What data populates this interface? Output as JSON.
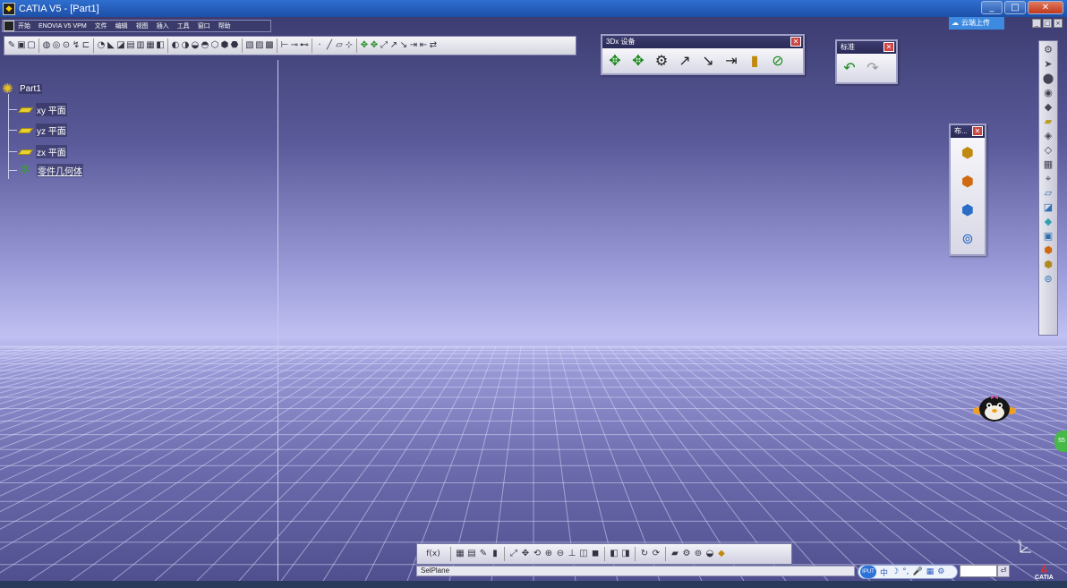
{
  "window": {
    "title": "CATIA V5 - [Part1]",
    "buttons": [
      "_",
      "□",
      "✕"
    ]
  },
  "menu": {
    "items": [
      "开始",
      "ENOVIA V5 VPM",
      "文件",
      "编辑",
      "视图",
      "插入",
      "工具",
      "窗口",
      "帮助"
    ]
  },
  "tree": {
    "root": "Part1",
    "children": [
      "xy 平面",
      "yz 平面",
      "zx 平面",
      "零件几何体"
    ]
  },
  "toolbars": {
    "devices_3dx": {
      "title": "3Dx 设备",
      "close": "✕"
    },
    "standard": {
      "title": "标准",
      "close": "✕"
    },
    "layout": {
      "title": "布...",
      "close": "✕"
    }
  },
  "cloud_button": {
    "label": "云端上传"
  },
  "status": {
    "text": "SelPlane"
  },
  "ime": {
    "logo": "IPUT",
    "items": [
      "中",
      "☽",
      "°,",
      "🎤",
      "▦",
      "⚙"
    ]
  },
  "command": {
    "value": "",
    "button": "⏎"
  },
  "brand": {
    "logo_text": "CATIA"
  },
  "green_tab": {
    "label": "55"
  },
  "colors": {
    "accent_green": "#1a8a1a",
    "title_blue": "#2f6fd0",
    "plane_yellow": "#e8d030"
  }
}
